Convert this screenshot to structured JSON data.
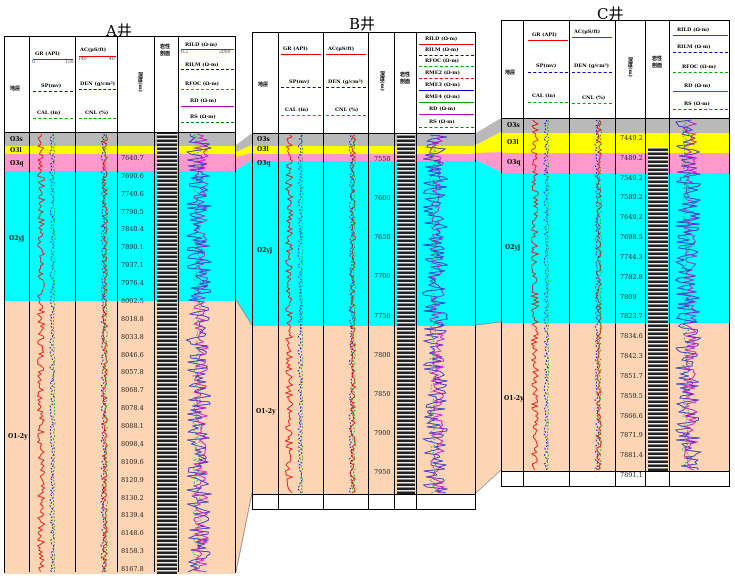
{
  "wells": {
    "A": {
      "title": "A井",
      "depths": [
        "7640.7",
        "7690.6",
        "7740.6",
        "7790.5",
        "7840.4",
        "7890.1",
        "7937.1",
        "7976.4",
        "8002.5",
        "8018.8",
        "8033.8",
        "8046.6",
        "8057.8",
        "8068.7",
        "8078.4",
        "8088.1",
        "8098.4",
        "8109.6",
        "8120.9",
        "8130.2",
        "8139.4",
        "8148.6",
        "8158.3",
        "8167.8"
      ]
    },
    "B": {
      "title": "B井",
      "depths": [
        "7550",
        "7600",
        "7650",
        "7700",
        "7750",
        "7800",
        "7850",
        "7900",
        "7950"
      ]
    },
    "C": {
      "title": "C井",
      "depths": [
        "7449.2",
        "7489.2",
        "7549.2",
        "7589.2",
        "7649.2",
        "7698.5",
        "7744.3",
        "7782.8",
        "7809",
        "7823.7",
        "7834.6",
        "7842.3",
        "7851.7",
        "7859.5",
        "7866.6",
        "7871.9",
        "7881.4",
        "7891.1"
      ]
    }
  },
  "headers": {
    "strata": "地层",
    "gr": "GR (API)",
    "sp": "SP(mv)",
    "cal": "CAL (in)",
    "ac": "AC(μS/ft)",
    "den": "DEN (g/cm³)",
    "cnl": "CNL (%)",
    "depth": "深度(m)",
    "litho": "岩性剖面",
    "rild": "RILD (Ω·m)",
    "rilm": "RILM (Ω·m)",
    "rfoc": "RFOC (Ω·m)",
    "rd": "RD (Ω·m)",
    "rs": "RS (Ω·m)",
    "rm2": "RME2 (Ω·m)",
    "rm3": "RME3 (Ω·m)",
    "rm4": "RME4 (Ω·m)"
  },
  "scales": {
    "gr": [
      "0",
      "150"
    ],
    "sp": [
      "0",
      "100"
    ],
    "cal": [
      "0",
      "20"
    ],
    "ac": [
      "140",
      "40"
    ],
    "den": [
      "2",
      "3"
    ],
    "cnl": [
      "60",
      "-15"
    ],
    "res": [
      "0.2",
      "2000"
    ],
    "res2": [
      "0.2",
      "200000"
    ]
  },
  "zones": [
    "O3s",
    "O3l",
    "O3q",
    "O2yj",
    "O1-2y"
  ],
  "colors": {
    "O3s": "#b9b9b9",
    "O3l": "#ffff00",
    "O3q": "#ff99cc",
    "O2yj": "#00ffff",
    "O1-2y": "#fcd5b4"
  }
}
